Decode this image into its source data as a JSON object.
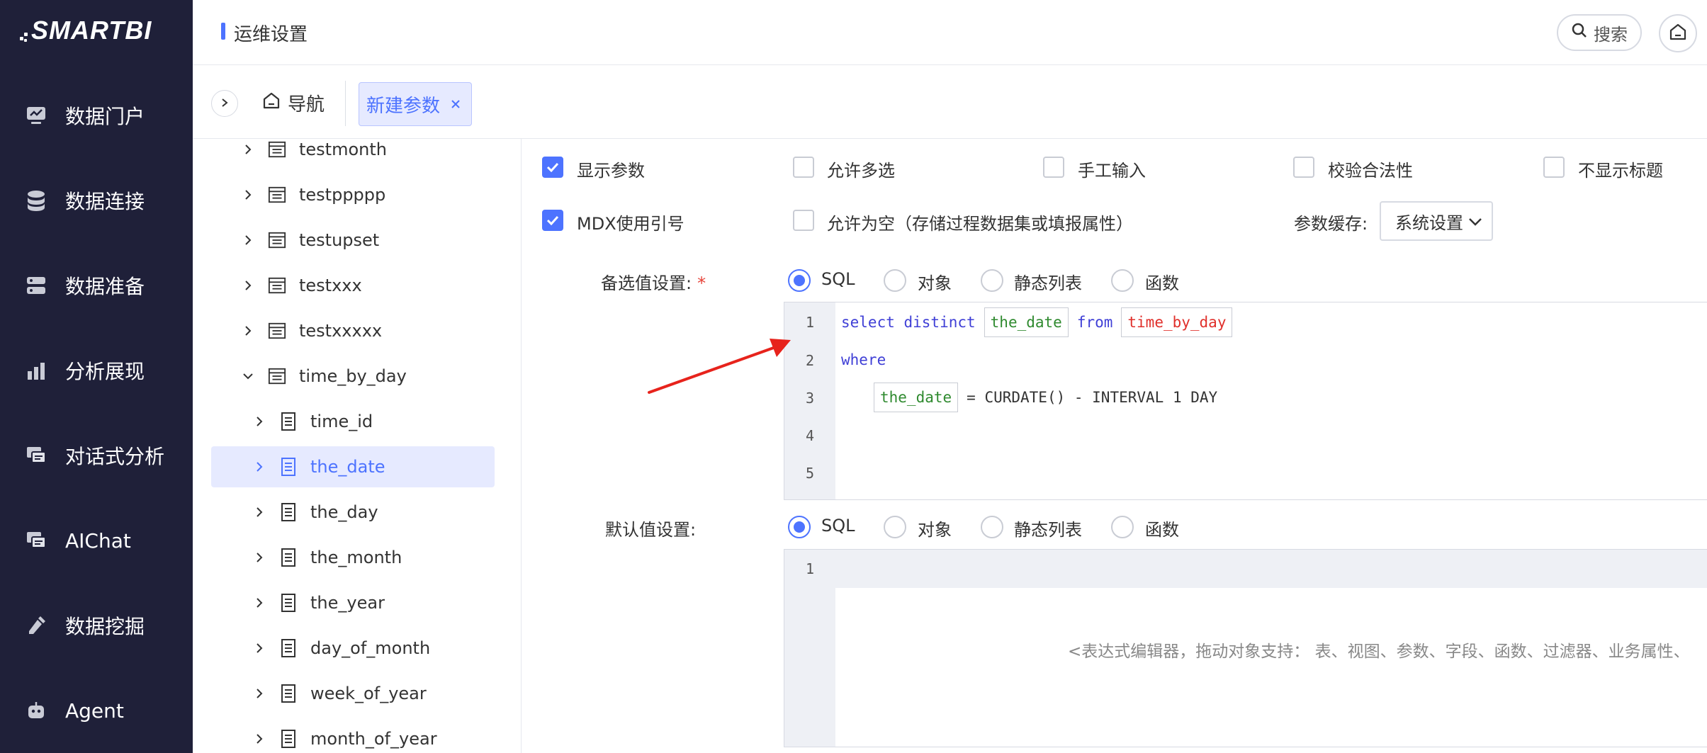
{
  "app": {
    "logo": "SMARTBI"
  },
  "sidebar": {
    "items": [
      {
        "label": "数据门户",
        "icon": "dashboard-icon"
      },
      {
        "label": "数据连接",
        "icon": "database-icon"
      },
      {
        "label": "数据准备",
        "icon": "server-icon"
      },
      {
        "label": "分析展现",
        "icon": "bar-chart-icon"
      },
      {
        "label": "对话式分析",
        "icon": "chat-icon"
      },
      {
        "label": "AIChat",
        "icon": "ai-chat-icon"
      },
      {
        "label": "数据挖掘",
        "icon": "mining-icon"
      },
      {
        "label": "Agent",
        "icon": "robot-icon"
      }
    ]
  },
  "header": {
    "title": "运维设置",
    "search_label": "搜索"
  },
  "tabs": {
    "home_label": "导航",
    "active_label": "新建参数"
  },
  "tree": {
    "items": [
      {
        "label": "testmonth",
        "level": 1
      },
      {
        "label": "testppppp",
        "level": 1
      },
      {
        "label": "testupset",
        "level": 1
      },
      {
        "label": "testxxx",
        "level": 1
      },
      {
        "label": "testxxxxx",
        "level": 1
      },
      {
        "label": "time_by_day",
        "level": 1,
        "expanded": true
      },
      {
        "label": "time_id",
        "level": 2
      },
      {
        "label": "the_date",
        "level": 2,
        "selected": true
      },
      {
        "label": "the_day",
        "level": 2
      },
      {
        "label": "the_month",
        "level": 2
      },
      {
        "label": "the_year",
        "level": 2
      },
      {
        "label": "day_of_month",
        "level": 2
      },
      {
        "label": "week_of_year",
        "level": 2
      },
      {
        "label": "month_of_year",
        "level": 2
      }
    ]
  },
  "options": {
    "show_param": {
      "label": "显示参数",
      "checked": true
    },
    "multi_select": {
      "label": "允许多选",
      "checked": false
    },
    "manual_input": {
      "label": "手工输入",
      "checked": false
    },
    "validate": {
      "label": "校验合法性",
      "checked": false
    },
    "hide_title": {
      "label": "不显示标题",
      "checked": false
    },
    "mdx_quote": {
      "label": "MDX使用引号",
      "checked": true
    },
    "allow_empty": {
      "label": "允许为空（存储过程数据集或填报属性）",
      "checked": false
    },
    "cache_label": "参数缓存:",
    "cache_value": "系统设置"
  },
  "candidate": {
    "label": "备选值设置:",
    "required_mark": "*",
    "radios": [
      "SQL",
      "对象",
      "静态列表",
      "函数"
    ],
    "selected": "SQL",
    "line_numbers": [
      "1",
      "2",
      "3",
      "4",
      "5"
    ],
    "code": {
      "l1_kw1": "select distinct",
      "l1_field": "the_date",
      "l1_kw2": "from",
      "l1_table": "time_by_day",
      "l2_kw": "where",
      "l3_field": "the_date",
      "l3_rest": "= CURDATE() - INTERVAL 1 DAY"
    }
  },
  "default_value": {
    "label": "默认值设置:",
    "radios": [
      "SQL",
      "对象",
      "静态列表",
      "函数"
    ],
    "selected": "SQL",
    "line_numbers": [
      "1"
    ],
    "hint": "<表达式编辑器，拖动对象支持： 表、视图、参数、字段、函数、过滤器、业务属性、"
  },
  "colors": {
    "sidebar_bg": "#1f2039",
    "accent": "#4d73ff",
    "keyword": "#3f3fd6",
    "field": "#2f8a2f",
    "table": "#e0302b",
    "annotation_arrow": "#e7231c"
  }
}
